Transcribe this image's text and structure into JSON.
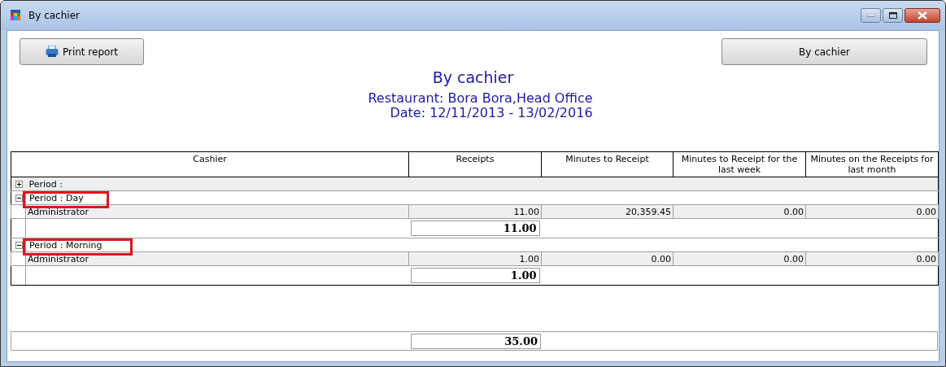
{
  "window": {
    "title": "By cachier"
  },
  "toolbar": {
    "print_button": "Print report",
    "report_button": "By cachier"
  },
  "report": {
    "title": "By cachier",
    "restaurant": "Restaurant: Bora Bora,Head Office",
    "date": "Date: 12/11/2013 - 13/02/2016"
  },
  "table": {
    "columns": [
      "Cashier",
      "Receipts",
      "Minutes to Receipt",
      "Minutes to Receipt for the last week",
      "Minutes on the Receipts for last month"
    ],
    "groups": [
      {
        "label": "Period :",
        "expanded": false,
        "highlighted": false
      },
      {
        "label": "Period : Day",
        "expanded": true,
        "highlighted": true,
        "rows": [
          {
            "cells": [
              "Administrator",
              "11.00",
              "20,359.45",
              "0.00",
              "0.00"
            ]
          }
        ],
        "total": "11.00"
      },
      {
        "label": "Period : Morning",
        "expanded": true,
        "highlighted": true,
        "rows": [
          {
            "cells": [
              "Administrator",
              "1.00",
              "0.00",
              "0.00",
              "0.00"
            ]
          }
        ],
        "total": "1.00"
      }
    ],
    "grand_total": "35.00"
  }
}
